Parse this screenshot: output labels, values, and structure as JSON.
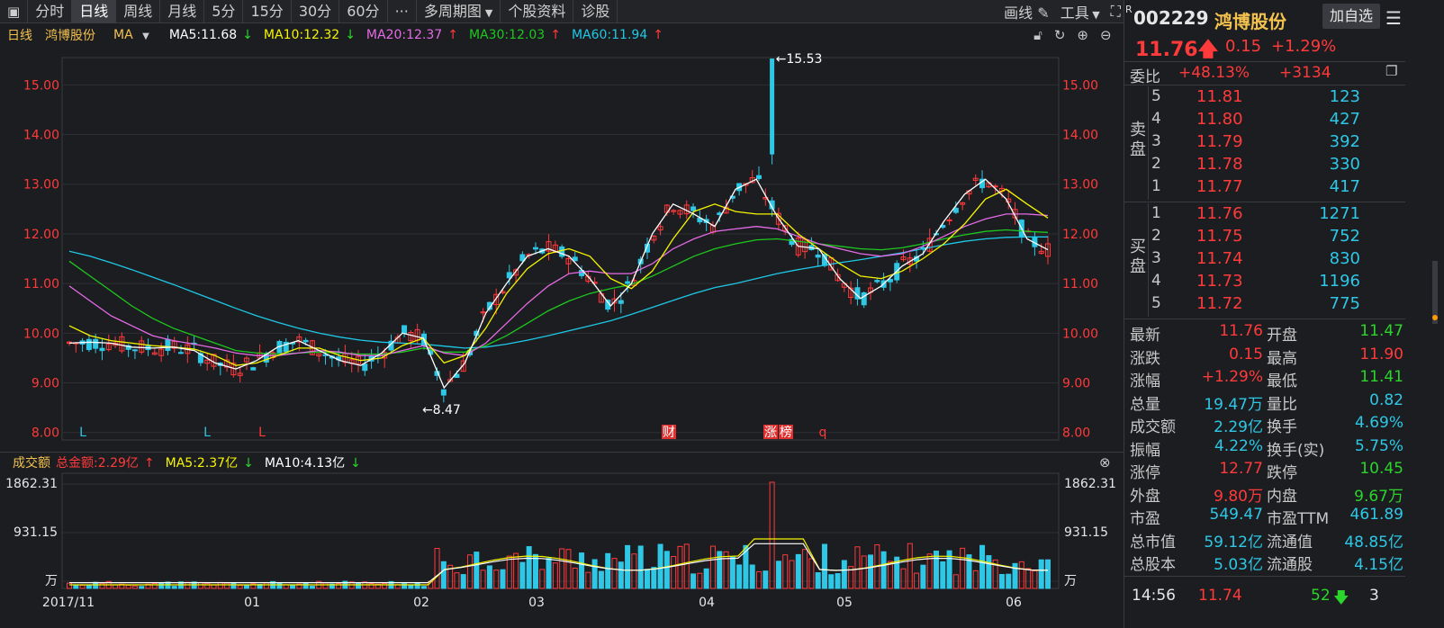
{
  "toolbar": {
    "items": [
      "分时",
      "日线",
      "周线",
      "月线",
      "5分",
      "15分",
      "30分",
      "60分",
      "···",
      "多周期图",
      "个股资料",
      "诊股"
    ],
    "active_index": 1,
    "draw_label": "画线",
    "tools_label": "工具"
  },
  "ma_legend": {
    "period": "日线",
    "name": "鸿博股份",
    "type": "MA",
    "ma5": "MA5:11.68",
    "ma10": "MA10:12.32",
    "ma20": "MA20:12.37",
    "ma30": "MA30:12.03",
    "ma60": "MA60:11.94",
    "colors": {
      "ma5": "#ffffff",
      "ma10": "#f5f500",
      "ma20": "#e66be6",
      "ma30": "#1ec81e",
      "ma60": "#1ec8e6"
    }
  },
  "vol_legend": {
    "label": "成交额",
    "total": "总金额:2.29亿",
    "ma5": "MA5:2.37亿",
    "ma10": "MA10:4.13亿"
  },
  "chart_data": [
    {
      "type": "candlestick",
      "title": "",
      "y_ticks": [
        "15.00",
        "14.00",
        "13.00",
        "12.00",
        "11.00",
        "10.00",
        "9.00",
        "8.00"
      ],
      "ylim": [
        7.85,
        15.55
      ],
      "x_ticks": [
        "2017/11",
        "01",
        "02",
        "03",
        "04",
        "05",
        "06"
      ],
      "annotations": {
        "high": "15.53",
        "low": "8.47"
      },
      "markers": [
        "L",
        "L",
        "L",
        "财",
        "涨",
        "榜",
        "q"
      ],
      "series": [
        {
          "name": "MA5",
          "values": [
            9.8,
            9.82,
            9.8,
            9.72,
            9.7,
            9.72,
            9.65,
            9.4,
            9.28,
            9.45,
            9.72,
            9.85,
            9.65,
            9.45,
            9.35,
            9.6,
            10.0,
            9.9,
            8.9,
            9.4,
            10.4,
            11.0,
            11.55,
            11.7,
            11.55,
            11.1,
            10.55,
            11.0,
            12.0,
            12.6,
            12.4,
            12.15,
            12.9,
            13.1,
            12.35,
            11.75,
            11.7,
            11.1,
            10.7,
            10.95,
            11.35,
            11.6,
            12.25,
            12.8,
            13.1,
            12.7,
            11.9,
            11.68
          ]
        },
        {
          "name": "MA10",
          "values": [
            10.15,
            9.95,
            9.85,
            9.8,
            9.75,
            9.72,
            9.68,
            9.55,
            9.35,
            9.4,
            9.55,
            9.7,
            9.7,
            9.55,
            9.45,
            9.5,
            9.75,
            9.9,
            9.4,
            9.55,
            10.1,
            10.8,
            11.3,
            11.6,
            11.7,
            11.55,
            11.1,
            10.9,
            11.25,
            11.9,
            12.45,
            12.6,
            12.45,
            12.4,
            12.4,
            12.0,
            11.7,
            11.4,
            11.15,
            11.1,
            11.25,
            11.5,
            11.8,
            12.2,
            12.7,
            12.9,
            12.6,
            12.32
          ]
        },
        {
          "name": "MA20",
          "values": [
            10.95,
            10.65,
            10.35,
            10.15,
            9.95,
            9.85,
            9.78,
            9.7,
            9.6,
            9.55,
            9.55,
            9.6,
            9.65,
            9.62,
            9.55,
            9.55,
            9.65,
            9.75,
            9.6,
            9.55,
            9.8,
            10.2,
            10.6,
            10.95,
            11.2,
            11.25,
            11.2,
            11.2,
            11.4,
            11.7,
            11.9,
            12.05,
            12.1,
            12.15,
            12.1,
            11.95,
            11.8,
            11.7,
            11.6,
            11.55,
            11.6,
            11.75,
            11.95,
            12.15,
            12.3,
            12.4,
            12.4,
            12.37
          ]
        },
        {
          "name": "MA30",
          "values": [
            11.45,
            11.15,
            10.85,
            10.55,
            10.3,
            10.1,
            9.95,
            9.8,
            9.65,
            9.6,
            9.58,
            9.6,
            9.62,
            9.6,
            9.58,
            9.58,
            9.62,
            9.7,
            9.62,
            9.62,
            9.75,
            9.95,
            10.2,
            10.45,
            10.65,
            10.8,
            10.9,
            10.98,
            11.15,
            11.35,
            11.55,
            11.7,
            11.8,
            11.88,
            11.9,
            11.85,
            11.8,
            11.75,
            11.7,
            11.68,
            11.72,
            11.8,
            11.9,
            11.98,
            12.05,
            12.08,
            12.05,
            12.03
          ]
        },
        {
          "name": "MA60",
          "values": [
            11.65,
            11.55,
            11.42,
            11.28,
            11.13,
            10.98,
            10.82,
            10.66,
            10.5,
            10.35,
            10.22,
            10.1,
            10.0,
            9.92,
            9.86,
            9.82,
            9.8,
            9.78,
            9.74,
            9.7,
            9.72,
            9.78,
            9.86,
            9.95,
            10.05,
            10.15,
            10.25,
            10.38,
            10.52,
            10.66,
            10.8,
            10.92,
            11.0,
            11.1,
            11.2,
            11.28,
            11.35,
            11.42,
            11.48,
            11.55,
            11.62,
            11.7,
            11.78,
            11.85,
            11.9,
            11.93,
            11.94,
            11.94
          ]
        }
      ]
    },
    {
      "type": "bar",
      "title": "",
      "y_ticks": [
        "1862.31",
        "931.15",
        "万"
      ],
      "ylim": [
        0,
        1862.31
      ]
    }
  ],
  "panel": {
    "r_mark": "R",
    "code": "002229",
    "name": "鸿博股份",
    "add_button": "加自选",
    "price": "11.76",
    "change": "0.15",
    "change_pct": "+1.29%",
    "weibi_label": "委比",
    "weibi_pct": "+48.13%",
    "weibi_diff": "+3134",
    "sell_label": "卖盘",
    "buy_label": "买盘",
    "sell": [
      {
        "lvl": "5",
        "price": "11.81",
        "vol": "123"
      },
      {
        "lvl": "4",
        "price": "11.80",
        "vol": "427"
      },
      {
        "lvl": "3",
        "price": "11.79",
        "vol": "392"
      },
      {
        "lvl": "2",
        "price": "11.78",
        "vol": "330"
      },
      {
        "lvl": "1",
        "price": "11.77",
        "vol": "417"
      }
    ],
    "buy": [
      {
        "lvl": "1",
        "price": "11.76",
        "vol": "1271"
      },
      {
        "lvl": "2",
        "price": "11.75",
        "vol": "752"
      },
      {
        "lvl": "3",
        "price": "11.74",
        "vol": "830"
      },
      {
        "lvl": "4",
        "price": "11.73",
        "vol": "1196"
      },
      {
        "lvl": "5",
        "price": "11.72",
        "vol": "775"
      }
    ],
    "quotes": [
      {
        "l1": "最新",
        "v1": "11.76",
        "c1": "up",
        "l2": "开盘",
        "v2": "11.47",
        "c2": "down"
      },
      {
        "l1": "涨跌",
        "v1": "0.15",
        "c1": "up",
        "l2": "最高",
        "v2": "11.90",
        "c2": "up"
      },
      {
        "l1": "涨幅",
        "v1": "+1.29%",
        "c1": "up",
        "l2": "最低",
        "v2": "11.41",
        "c2": "down"
      },
      {
        "l1": "总量",
        "v1": "19.47万",
        "c1": "cyan",
        "l2": "量比",
        "v2": "0.82",
        "c2": "cyan"
      },
      {
        "l1": "成交额",
        "v1": "2.29亿",
        "c1": "cyan",
        "l2": "换手",
        "v2": "4.69%",
        "c2": "cyan"
      },
      {
        "l1": "振幅",
        "v1": "4.22%",
        "c1": "cyan",
        "l2": "换手(实)",
        "v2": "5.75%",
        "c2": "cyan"
      },
      {
        "l1": "涨停",
        "v1": "12.77",
        "c1": "up",
        "l2": "跌停",
        "v2": "10.45",
        "c2": "down"
      },
      {
        "l1": "外盘",
        "v1": "9.80万",
        "c1": "up",
        "l2": "内盘",
        "v2": "9.67万",
        "c2": "down"
      },
      {
        "l1": "市盈",
        "v1": "549.47",
        "c1": "cyan",
        "l2": "市盈TTM",
        "v2": "461.89",
        "c2": "cyan"
      },
      {
        "l1": "总市值",
        "v1": "59.12亿",
        "c1": "cyan",
        "l2": "流通值",
        "v2": "48.85亿",
        "c2": "cyan"
      },
      {
        "l1": "总股本",
        "v1": "5.03亿",
        "c1": "cyan",
        "l2": "流通股",
        "v2": "4.15亿",
        "c2": "cyan"
      }
    ],
    "tick": {
      "time": "14:56",
      "price": "11.74",
      "vol": "52",
      "count": "3"
    }
  }
}
